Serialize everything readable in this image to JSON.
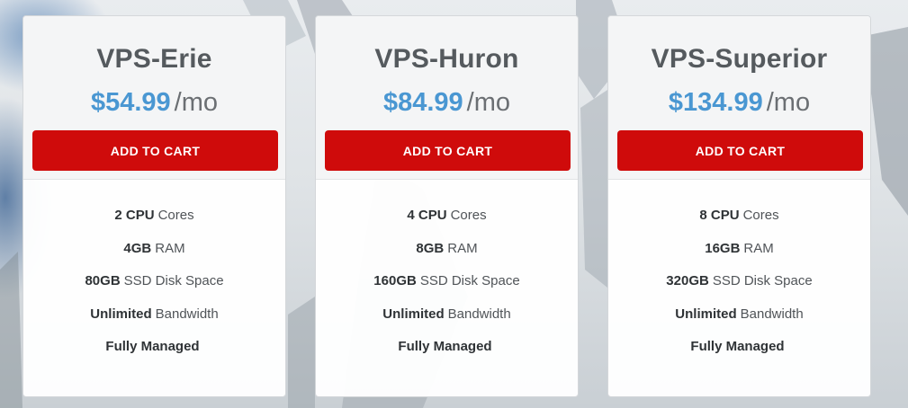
{
  "plans": [
    {
      "name": "VPS-Erie",
      "price": "$54.99",
      "period": "/mo",
      "button_label": "ADD TO CART",
      "features": [
        {
          "bold": "2 CPU",
          "text": "Cores"
        },
        {
          "bold": "4GB",
          "text": "RAM"
        },
        {
          "bold": "80GB",
          "text": "SSD Disk Space"
        },
        {
          "bold": "Unlimited",
          "text": "Bandwidth"
        },
        {
          "bold": "Fully Managed",
          "text": ""
        }
      ]
    },
    {
      "name": "VPS-Huron",
      "price": "$84.99",
      "period": "/mo",
      "button_label": "ADD TO CART",
      "features": [
        {
          "bold": "4 CPU",
          "text": "Cores"
        },
        {
          "bold": "8GB",
          "text": "RAM"
        },
        {
          "bold": "160GB",
          "text": "SSD Disk Space"
        },
        {
          "bold": "Unlimited",
          "text": "Bandwidth"
        },
        {
          "bold": "Fully Managed",
          "text": ""
        }
      ]
    },
    {
      "name": "VPS-Superior",
      "price": "$134.99",
      "period": "/mo",
      "button_label": "ADD TO CART",
      "features": [
        {
          "bold": "8 CPU",
          "text": "Cores"
        },
        {
          "bold": "16GB",
          "text": "RAM"
        },
        {
          "bold": "320GB",
          "text": "SSD Disk Space"
        },
        {
          "bold": "Unlimited",
          "text": "Bandwidth"
        },
        {
          "bold": "Fully Managed",
          "text": ""
        }
      ]
    }
  ],
  "colors": {
    "price": "#4a97d2",
    "button": "#cf0b0b",
    "title": "#555a5e"
  }
}
